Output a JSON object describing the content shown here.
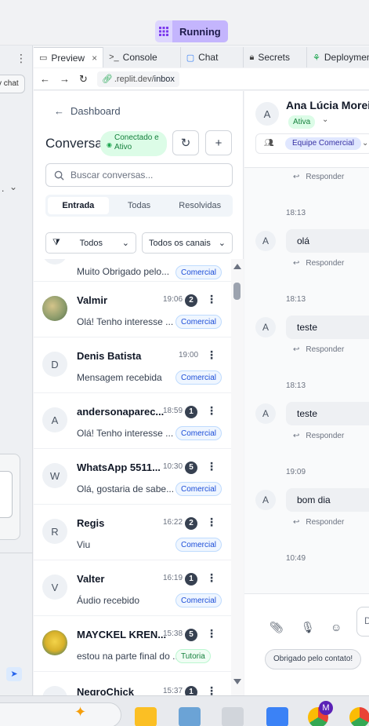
{
  "topbar": {
    "run_status": "Running"
  },
  "left_pane": {
    "chat_button": "v chat"
  },
  "tabs": [
    {
      "label": "Preview",
      "icon": "monitor-icon",
      "active": true
    },
    {
      "label": "Console",
      "icon": "terminal-icon"
    },
    {
      "label": "Chat",
      "icon": "chat-bubble-icon"
    },
    {
      "label": "Secrets",
      "icon": "lock-icon"
    },
    {
      "label": "Deployments",
      "icon": "deploy-icon"
    }
  ],
  "address": {
    "domain": ".replit.dev/",
    "path": "inbox"
  },
  "inbox": {
    "back_label": "Dashboard",
    "title": "Conversas",
    "connection_status": "Conectado e Ativo",
    "search_placeholder": "Buscar conversas...",
    "filter_tabs": [
      "Entrada",
      "Todas",
      "Resolvidas"
    ],
    "status_filter": "Todos",
    "channel_filter": "Todos os canais",
    "conversations": [
      {
        "avatar": "",
        "name": "",
        "time": "",
        "unread": "",
        "preview": "Muito Obrigado pelo...",
        "tag": "Comercial"
      },
      {
        "avatar": "photo",
        "name": "Valmir",
        "time": "19:06",
        "unread": "2",
        "preview": "Olá! Tenho interesse ...",
        "tag": "Comercial"
      },
      {
        "avatar": "D",
        "name": "Denis Batista",
        "time": "19:00",
        "unread": "",
        "preview": "Mensagem recebida",
        "tag": "Comercial"
      },
      {
        "avatar": "A",
        "name": "andersonaparec...",
        "time": "18:59",
        "unread": "1",
        "preview": "Olá! Tenho interesse ...",
        "tag": "Comercial"
      },
      {
        "avatar": "W",
        "name": "WhatsApp 5511...",
        "time": "10:30",
        "unread": "5",
        "preview": "Olá, gostaria de sabe...",
        "tag": "Comercial"
      },
      {
        "avatar": "R",
        "name": "Regis",
        "time": "16:22",
        "unread": "2",
        "preview": "Viu",
        "tag": "Comercial"
      },
      {
        "avatar": "V",
        "name": "Valter",
        "time": "16:19",
        "unread": "1",
        "preview": "Áudio recebido",
        "tag": "Comercial"
      },
      {
        "avatar": "photo",
        "name": "MAYCKEL KREN...",
        "time": "15:38",
        "unread": "5",
        "preview": "estou na parte final do ...",
        "tag": "Tutoria"
      },
      {
        "avatar": "",
        "name": "NegroChick",
        "time": "15:37",
        "unread": "1",
        "preview": "",
        "tag": ""
      }
    ]
  },
  "chat": {
    "contact_initial": "A",
    "contact_name": "Ana Lúcia Moreira",
    "status": "Ativa",
    "team": "Equipe Comercial",
    "reply_label": "Responder",
    "messages": [
      {
        "time": "18:13",
        "text": "olá"
      },
      {
        "time": "18:13",
        "text": "teste"
      },
      {
        "time": "18:13",
        "text": "teste"
      },
      {
        "time": "19:09",
        "text": "bom dia"
      }
    ],
    "last_time": "10:49",
    "input_placeholder": "D",
    "quick_reply": "Obrigado pelo contato!"
  },
  "taskbar": {
    "badge": "M"
  }
}
